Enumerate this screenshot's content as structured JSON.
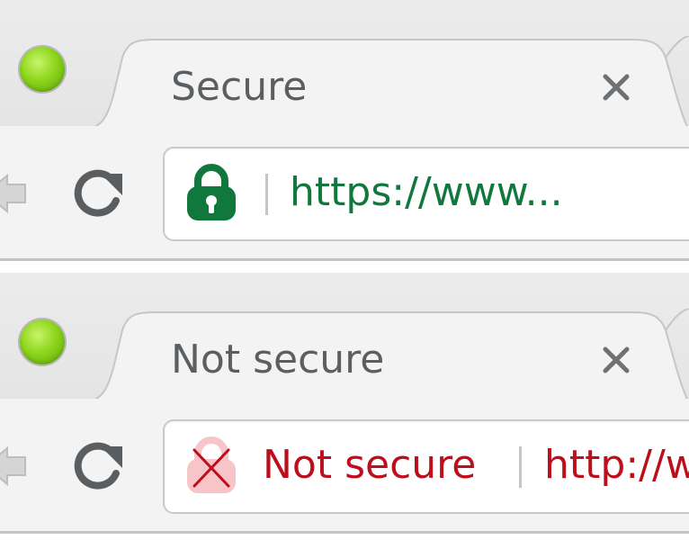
{
  "secure_window": {
    "tab_title": "Secure",
    "address_bar": {
      "url": "https://www...",
      "security_icon": "lock-icon",
      "url_color": "#10783c"
    }
  },
  "insecure_window": {
    "tab_title": "Not secure",
    "address_bar": {
      "security_label": "Not secure",
      "url": "http://w",
      "security_icon": "broken-lock-icon",
      "text_color": "#bd0e1c"
    }
  },
  "colors": {
    "traffic_light": "#8ed61c",
    "secure_green": "#10783c",
    "insecure_red": "#bd0e1c",
    "insecure_lock_fill": "#f7c4c8"
  }
}
